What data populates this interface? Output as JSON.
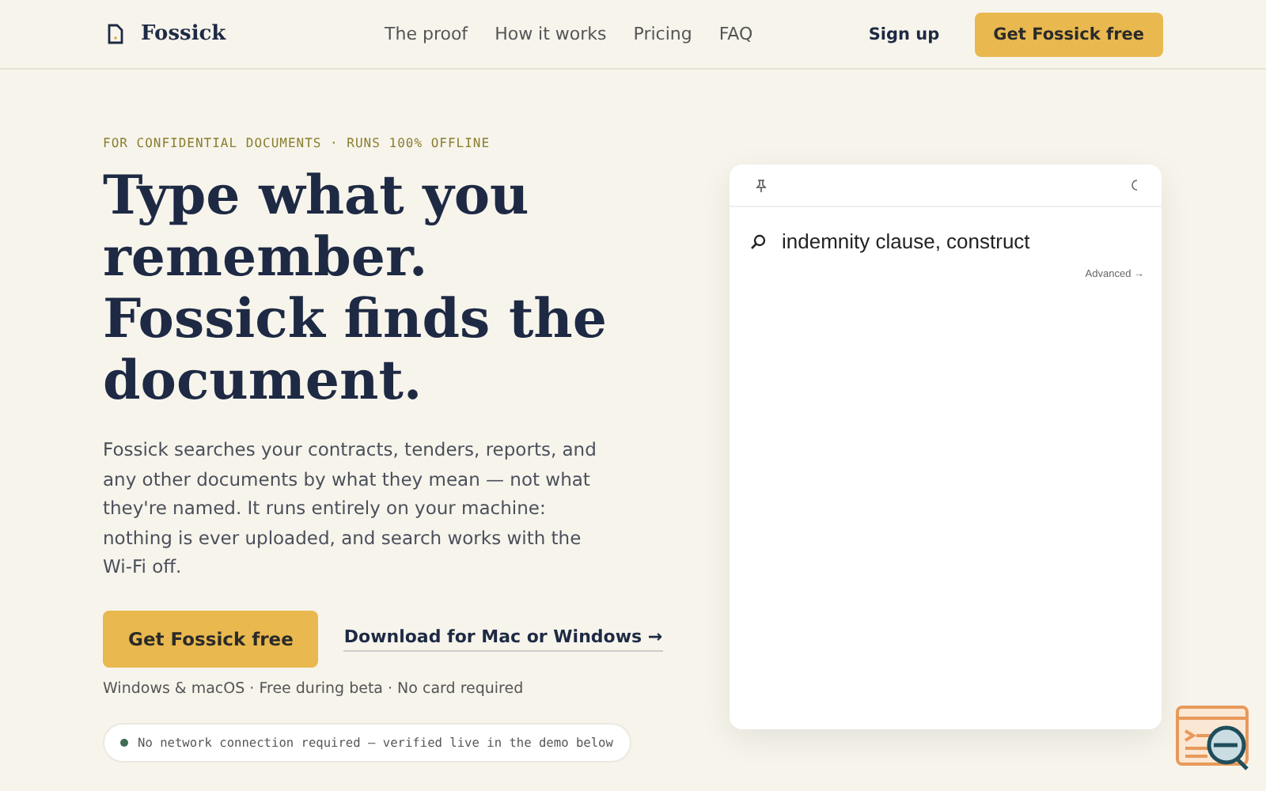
{
  "brand": {
    "name": "Fossick"
  },
  "nav": [
    "The proof",
    "How it works",
    "Pricing",
    "FAQ"
  ],
  "header_actions": {
    "signup": "Sign up",
    "cta": "Get Fossick free"
  },
  "hero": {
    "eyebrow": "FOR CONFIDENTIAL DOCUMENTS · RUNS 100% OFFLINE",
    "headline": "Type what you remember. Fossick finds the document.",
    "body": "Fossick searches your contracts, tenders, reports, and any other documents by what they mean — not what they're named. It runs entirely on your machine: nothing is ever uploaded, and search works with the Wi-Fi off.",
    "primary": "Get Fossick free",
    "secondary": "Download for Mac or Windows →",
    "note": "Windows & macOS · Free during beta · No card required",
    "status": {
      "text": "No network connection required — verified live in the demo below",
      "color": "#3f6b55"
    }
  },
  "demo": {
    "query": "indemnity clause, construct",
    "advanced": "Advanced →"
  }
}
